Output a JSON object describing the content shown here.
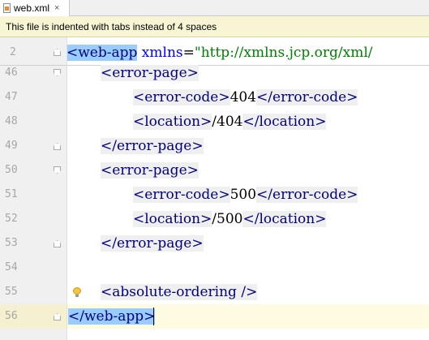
{
  "tab": {
    "filename": "web.xml",
    "close_glyph": "×",
    "icon": "xml-file-icon"
  },
  "notification": {
    "text": "This file is indented with tabs instead of 4 spaces"
  },
  "editor": {
    "sticky_line": {
      "line_number": "2",
      "tag_open": "<web-app",
      "attr_name": "xmlns",
      "equals": "=",
      "attr_value": "\"http://xmlns.jcp.org/xml/"
    },
    "lines": [
      {
        "n": "46",
        "parts": [
          "<error-page>"
        ]
      },
      {
        "n": "47",
        "parts": [
          "<error-code>",
          "404",
          "</error-code>"
        ]
      },
      {
        "n": "48",
        "parts": [
          "<location>",
          "/404",
          "</location>"
        ]
      },
      {
        "n": "49",
        "parts": [
          "</error-page>"
        ]
      },
      {
        "n": "50",
        "parts": [
          "<error-page>"
        ]
      },
      {
        "n": "51",
        "parts": [
          "<error-code>",
          "500",
          "</error-code>"
        ]
      },
      {
        "n": "52",
        "parts": [
          "<location>",
          "/500",
          "</location>"
        ]
      },
      {
        "n": "53",
        "parts": [
          "</error-page>"
        ]
      },
      {
        "n": "54",
        "parts": []
      },
      {
        "n": "55",
        "parts": [
          "<absolute-ordering />"
        ]
      },
      {
        "n": "56",
        "parts": [
          "</web-app>"
        ]
      }
    ],
    "intention_icon": "lightbulb-icon",
    "colors": {
      "tag_text": "#000080",
      "tag_bg": "#efefef",
      "tag_match_bg": "#99ccff",
      "attr_name": "#0000ff",
      "attr_value": "#008000",
      "caret_row_bg": "#fffbe0",
      "notification_bg": "#f8f5d5"
    }
  }
}
